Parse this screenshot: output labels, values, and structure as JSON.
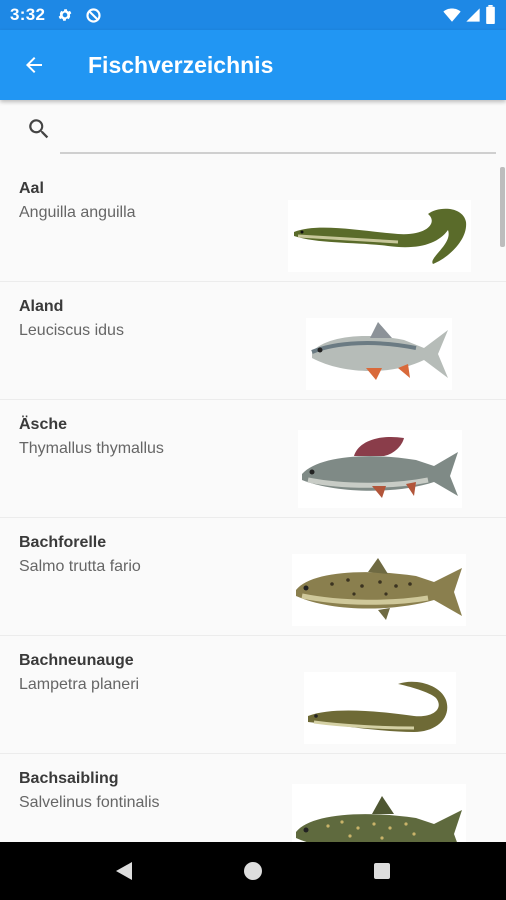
{
  "status_bar": {
    "time": "3:32",
    "left_icons": [
      "settings-icon",
      "data-saver-icon"
    ],
    "right_icons": [
      "wifi-icon",
      "cell-signal-icon",
      "battery-icon"
    ]
  },
  "app_bar": {
    "title": "Fischverzeichnis",
    "back_icon": "arrow-back-icon",
    "color": "#2196f3",
    "status_color": "#1e88e5"
  },
  "search": {
    "icon": "search-icon",
    "value": "",
    "placeholder": ""
  },
  "fish_list": [
    {
      "name": "Aal",
      "latin": "Anguilla anguilla"
    },
    {
      "name": "Aland",
      "latin": "Leuciscus idus"
    },
    {
      "name": "Äsche",
      "latin": "Thymallus thymallus"
    },
    {
      "name": "Bachforelle",
      "latin": "Salmo trutta fario"
    },
    {
      "name": "Bachneunauge",
      "latin": "Lampetra planeri"
    },
    {
      "name": "Bachsaibling",
      "latin": "Salvelinus fontinalis"
    }
  ],
  "nav_bar": {
    "buttons": [
      "back-triangle-icon",
      "home-circle-icon",
      "recents-square-icon"
    ]
  }
}
